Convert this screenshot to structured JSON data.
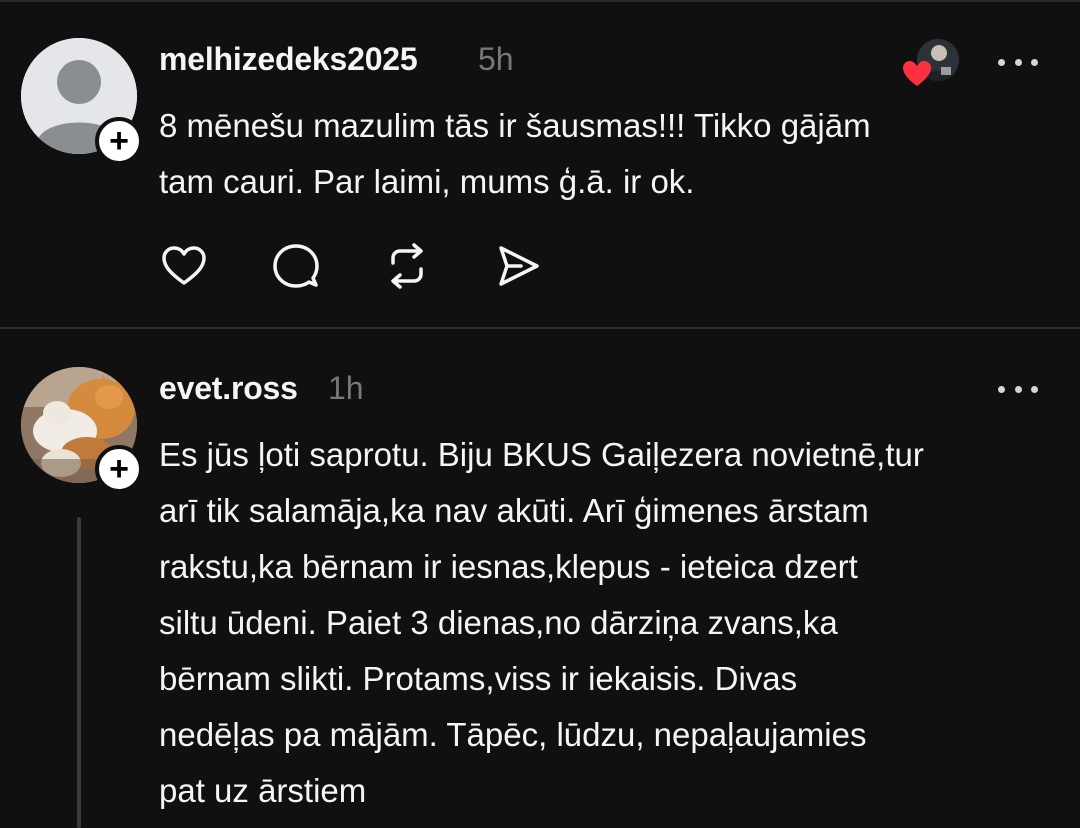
{
  "posts": [
    {
      "username": "melhizedeks2025",
      "time": "5h",
      "text": "8 mēnešu mazulim tās ir šausmas!!! Tikko gājām\ntam cauri. Par laimi, mums ģ.ā. ir ok.",
      "avatar_icon": "default-person-avatar",
      "liked_by_author": true
    },
    {
      "username": "evet.ross",
      "time": "1h",
      "text": "Es jūs ļoti saprotu. Biju BKUS Gaiļezera novietnē,tur\narī tik salamāja,ka nav akūti.  Arī ģimenes ārstam\nrakstu,ka bērnam ir iesnas,klepus - ieteica dzert\nsiltu ūdeni. Paiet 3 dienas,no dārziņa zvans,ka\nbērnam slikti. Protams,viss ir iekaisis. Divas\nnedēļas pa mājām. Tāpēc, lūdzu, nepaļaujamies\npat uz ārstiem",
      "avatar_icon": "cats-photo-avatar"
    }
  ],
  "follow_badge": "+",
  "actions": [
    "heart-icon",
    "comment-icon",
    "repost-icon",
    "share-icon"
  ],
  "colors": {
    "background": "#101010",
    "text": "#f3f5f7",
    "muted": "#777777",
    "heart": "#ff3040"
  }
}
